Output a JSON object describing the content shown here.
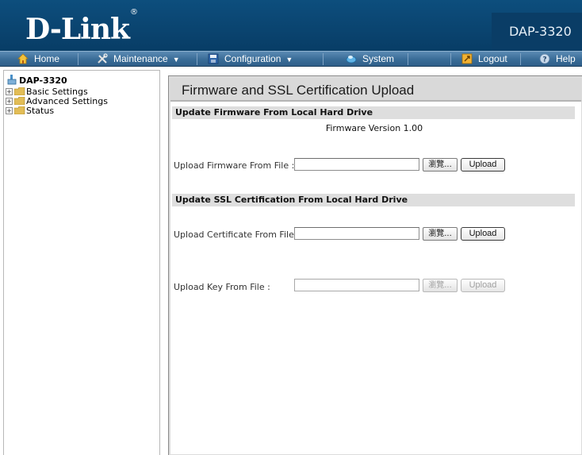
{
  "header": {
    "brand": "D-Link",
    "brand_mark": "®",
    "model": "DAP-3320"
  },
  "menu": {
    "home": "Home",
    "maintenance": "Maintenance",
    "configuration": "Configuration",
    "system": "System",
    "logout": "Logout",
    "help": "Help"
  },
  "tree": {
    "root": "DAP-3320",
    "items": [
      "Basic Settings",
      "Advanced Settings",
      "Status"
    ],
    "expander_symbol": "+"
  },
  "page": {
    "title": "Firmware and SSL Certification Upload",
    "firmware_section": {
      "heading": "Update Firmware From Local Hard Drive",
      "version_label": "Firmware Version",
      "version_value": "1.00",
      "upload_label": "Upload Firmware From File :",
      "browse_label": "瀏覽...",
      "upload_button": "Upload",
      "file_value": ""
    },
    "ssl_section": {
      "heading": "Update SSL Certification From Local Hard Drive",
      "cert_label": "Upload Certificate From File :",
      "cert_browse_label": "瀏覽...",
      "cert_upload_button": "Upload",
      "key_label": "Upload Key From File :",
      "key_browse_label": "瀏覽...",
      "key_upload_button": "Upload"
    }
  },
  "colors": {
    "header_bg": "#0d4e7d",
    "menubar_bg": "#396c97",
    "section_bg": "#dedede"
  }
}
